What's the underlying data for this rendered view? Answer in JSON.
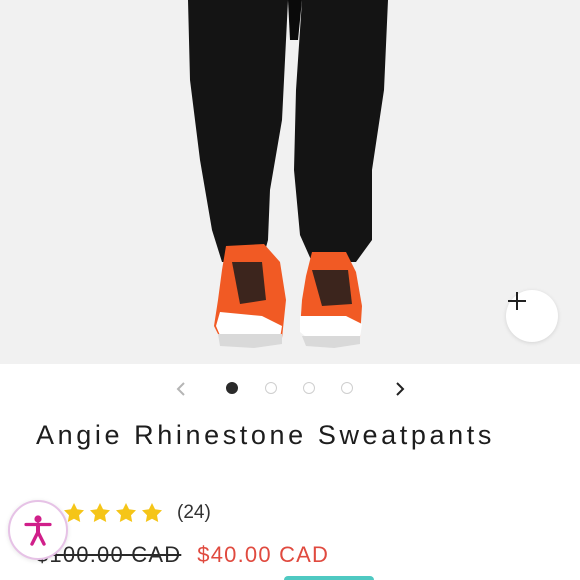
{
  "product": {
    "title": "Angie Rhinestone Sweatpants",
    "image_alt": "Model wearing black sweatpants with orange and white sneakers"
  },
  "gallery": {
    "image_count": 4,
    "active_index": 0,
    "prev_icon": "chevron-left-icon",
    "next_icon": "chevron-right-icon",
    "zoom_icon": "plus-icon"
  },
  "rating": {
    "stars": 5,
    "review_count_label": "(24)"
  },
  "pricing": {
    "compare_at": "$100.00 CAD",
    "sale": "$40.00 CAD"
  },
  "accessibility": {
    "icon": "accessibility-person-icon"
  },
  "colors": {
    "sale_price": "#e04a3f",
    "star": "#f5c518",
    "accessibility_accent": "#d01f8a",
    "bottom_strip": "#4fc9c2"
  }
}
